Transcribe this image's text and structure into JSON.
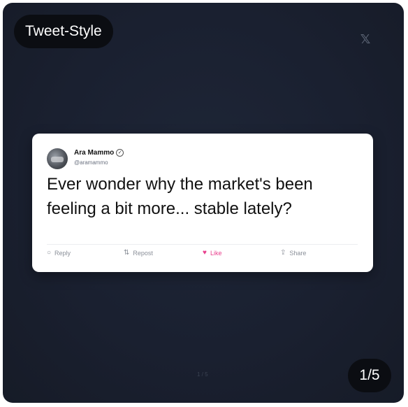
{
  "tag_label": "Tweet-Style",
  "brand_icon": "x-logo-icon",
  "tweet": {
    "author_name": "Ara Mammo",
    "author_handle": "@aramammo",
    "text": "Ever wonder why the market's been feeling a bit more... stable lately?",
    "actions": {
      "reply": "Reply",
      "repost": "Repost",
      "like": "Like",
      "share": "Share"
    },
    "like_color": "#e83e8c"
  },
  "pagination": {
    "small": "1 / 5",
    "large": "1/5"
  }
}
